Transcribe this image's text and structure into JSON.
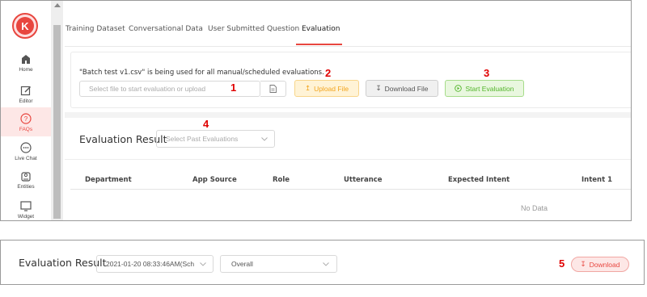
{
  "sidebar": {
    "logo_letter": "K",
    "items": [
      {
        "label": "Home",
        "icon": "home-icon"
      },
      {
        "label": "Editor",
        "icon": "edit-icon"
      },
      {
        "label": "FAQs",
        "icon": "question-icon",
        "active": true
      },
      {
        "label": "Live Chat",
        "icon": "chat-icon"
      },
      {
        "label": "Entities",
        "icon": "entities-icon"
      },
      {
        "label": "Widget",
        "icon": "monitor-icon"
      }
    ]
  },
  "tabs": [
    "Training Dataset",
    "Conversational Data",
    "User Submitted Question",
    "Evaluation"
  ],
  "active_tab": "Evaluation",
  "evaluation": {
    "info_text": "\"Batch test v1.csv\" is being used for all manual/scheduled evaluations.",
    "file_placeholder": "Select file to start evaluation or upload",
    "upload_label": "Upload File",
    "download_file_label": "Download File",
    "start_label": "Start Evaluation"
  },
  "result": {
    "title": "Evaluation Result",
    "past_placeholder": "Select Past Evaluations",
    "columns": [
      "Department",
      "App Source",
      "Role",
      "Utterance",
      "Expected Intent",
      "Intent 1"
    ],
    "empty_text": "No Data"
  },
  "bottom": {
    "title": "Evaluation Result",
    "selected_date": "2021-01-20 08:33:46AM(Sch",
    "selected_scope": "Overall",
    "download_label": "Download"
  },
  "annotations": [
    "1",
    "2",
    "3",
    "4",
    "5"
  ],
  "colors": {
    "brand_red": "#e8463f",
    "upload_orange": "#f2a51f",
    "start_green": "#52b52a",
    "annotation_red": "#e00000"
  }
}
